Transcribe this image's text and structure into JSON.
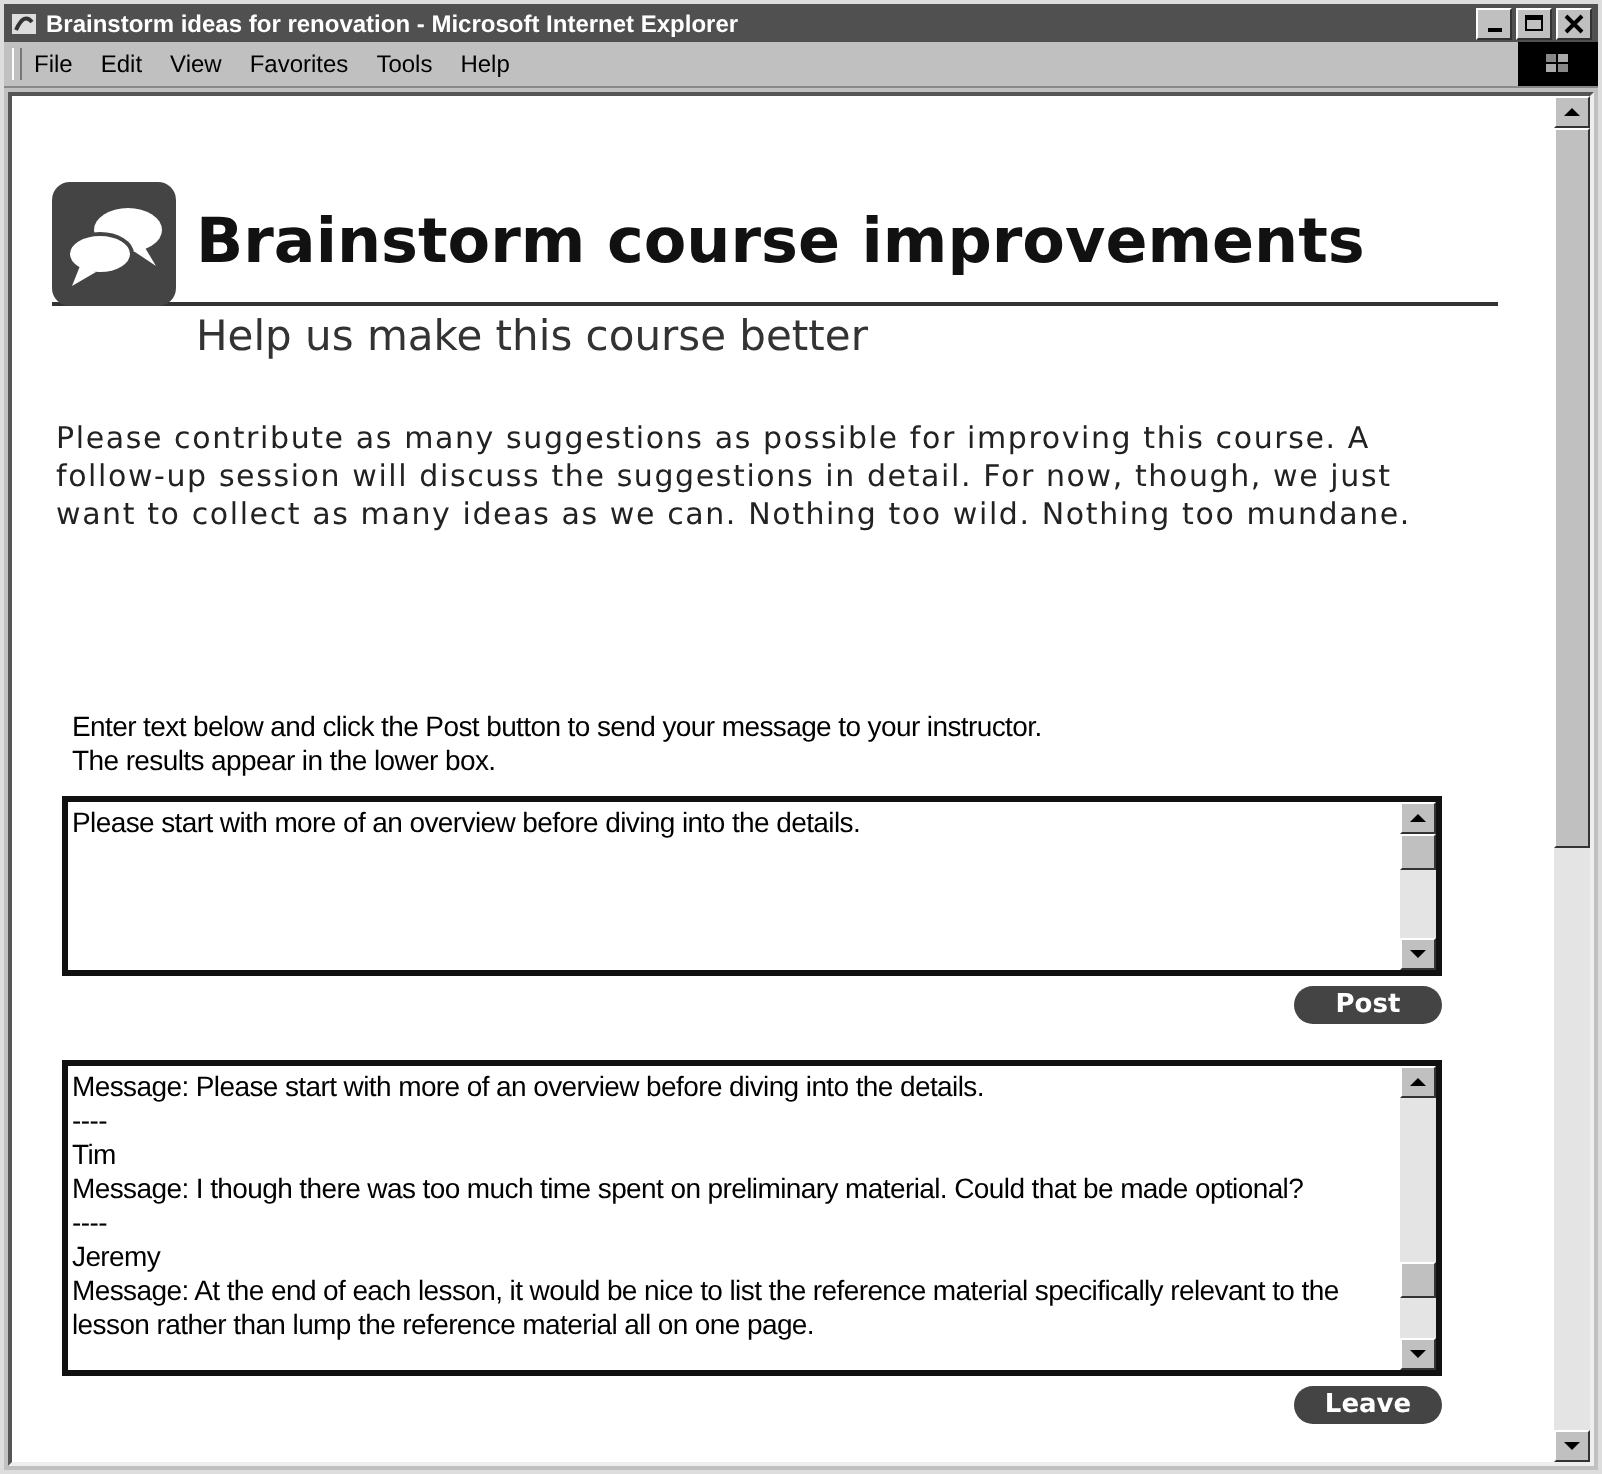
{
  "window": {
    "title": "Brainstorm ideas for renovation - Microsoft Internet Explorer"
  },
  "menu": [
    "File",
    "Edit",
    "View",
    "Favorites",
    "Tools",
    "Help"
  ],
  "page": {
    "title": "Brainstorm course improvements",
    "subtitle": "Help us make this course better",
    "intro": "Please contribute as many suggestions as possible for improving this course. A follow-up session will discuss the suggestions in detail. For now, though, we just want to collect as many ideas as we can. Nothing too wild. Nothing too mundane.",
    "instructions": [
      "Enter text below and click the Post button to send your message to your instructor.",
      "The results appear in the lower box."
    ],
    "message_input": {
      "value": "Please start with more of an overview before diving into the details."
    },
    "post_button": "Post",
    "log": [
      "Message: Please start with more of an overview before diving into the details.",
      "----",
      "Tim",
      "Message: I though there was too much time spent on preliminary material. Could that be made optional?",
      "----",
      "Jeremy",
      "Message: At the end of each lesson, it would be nice to list the reference material specifically relevant to the",
      "lesson rather than lump the reference material all on one page."
    ],
    "leave_button": "Leave"
  }
}
